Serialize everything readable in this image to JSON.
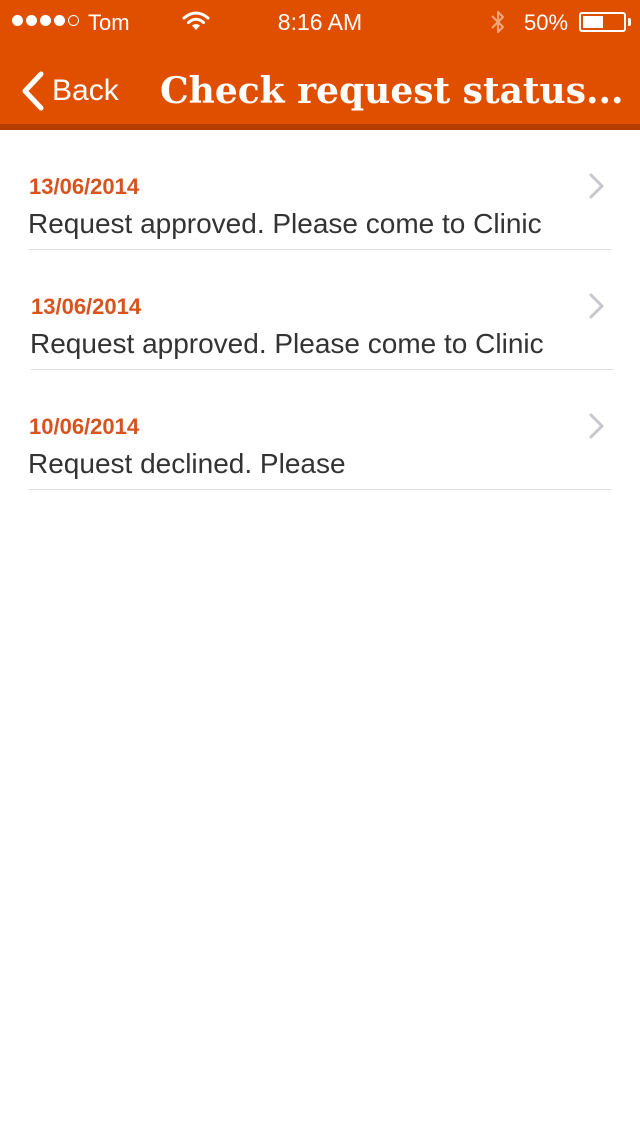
{
  "status_bar": {
    "carrier": "Tom",
    "time": "8:16 AM",
    "battery_percent_text": "50%",
    "battery_level": 0.5
  },
  "nav": {
    "back_label": "Back",
    "title": "Check request status..."
  },
  "requests": [
    {
      "date": "13/06/2014",
      "message": "Request approved. Please come to Clinic"
    },
    {
      "date": "13/06/2014",
      "message": "Request approved. Please come to Clinic"
    },
    {
      "date": "10/06/2014",
      "message": "Request declined. Please"
    }
  ],
  "colors": {
    "brand": "#e04f00",
    "date_text": "#d9531e"
  }
}
